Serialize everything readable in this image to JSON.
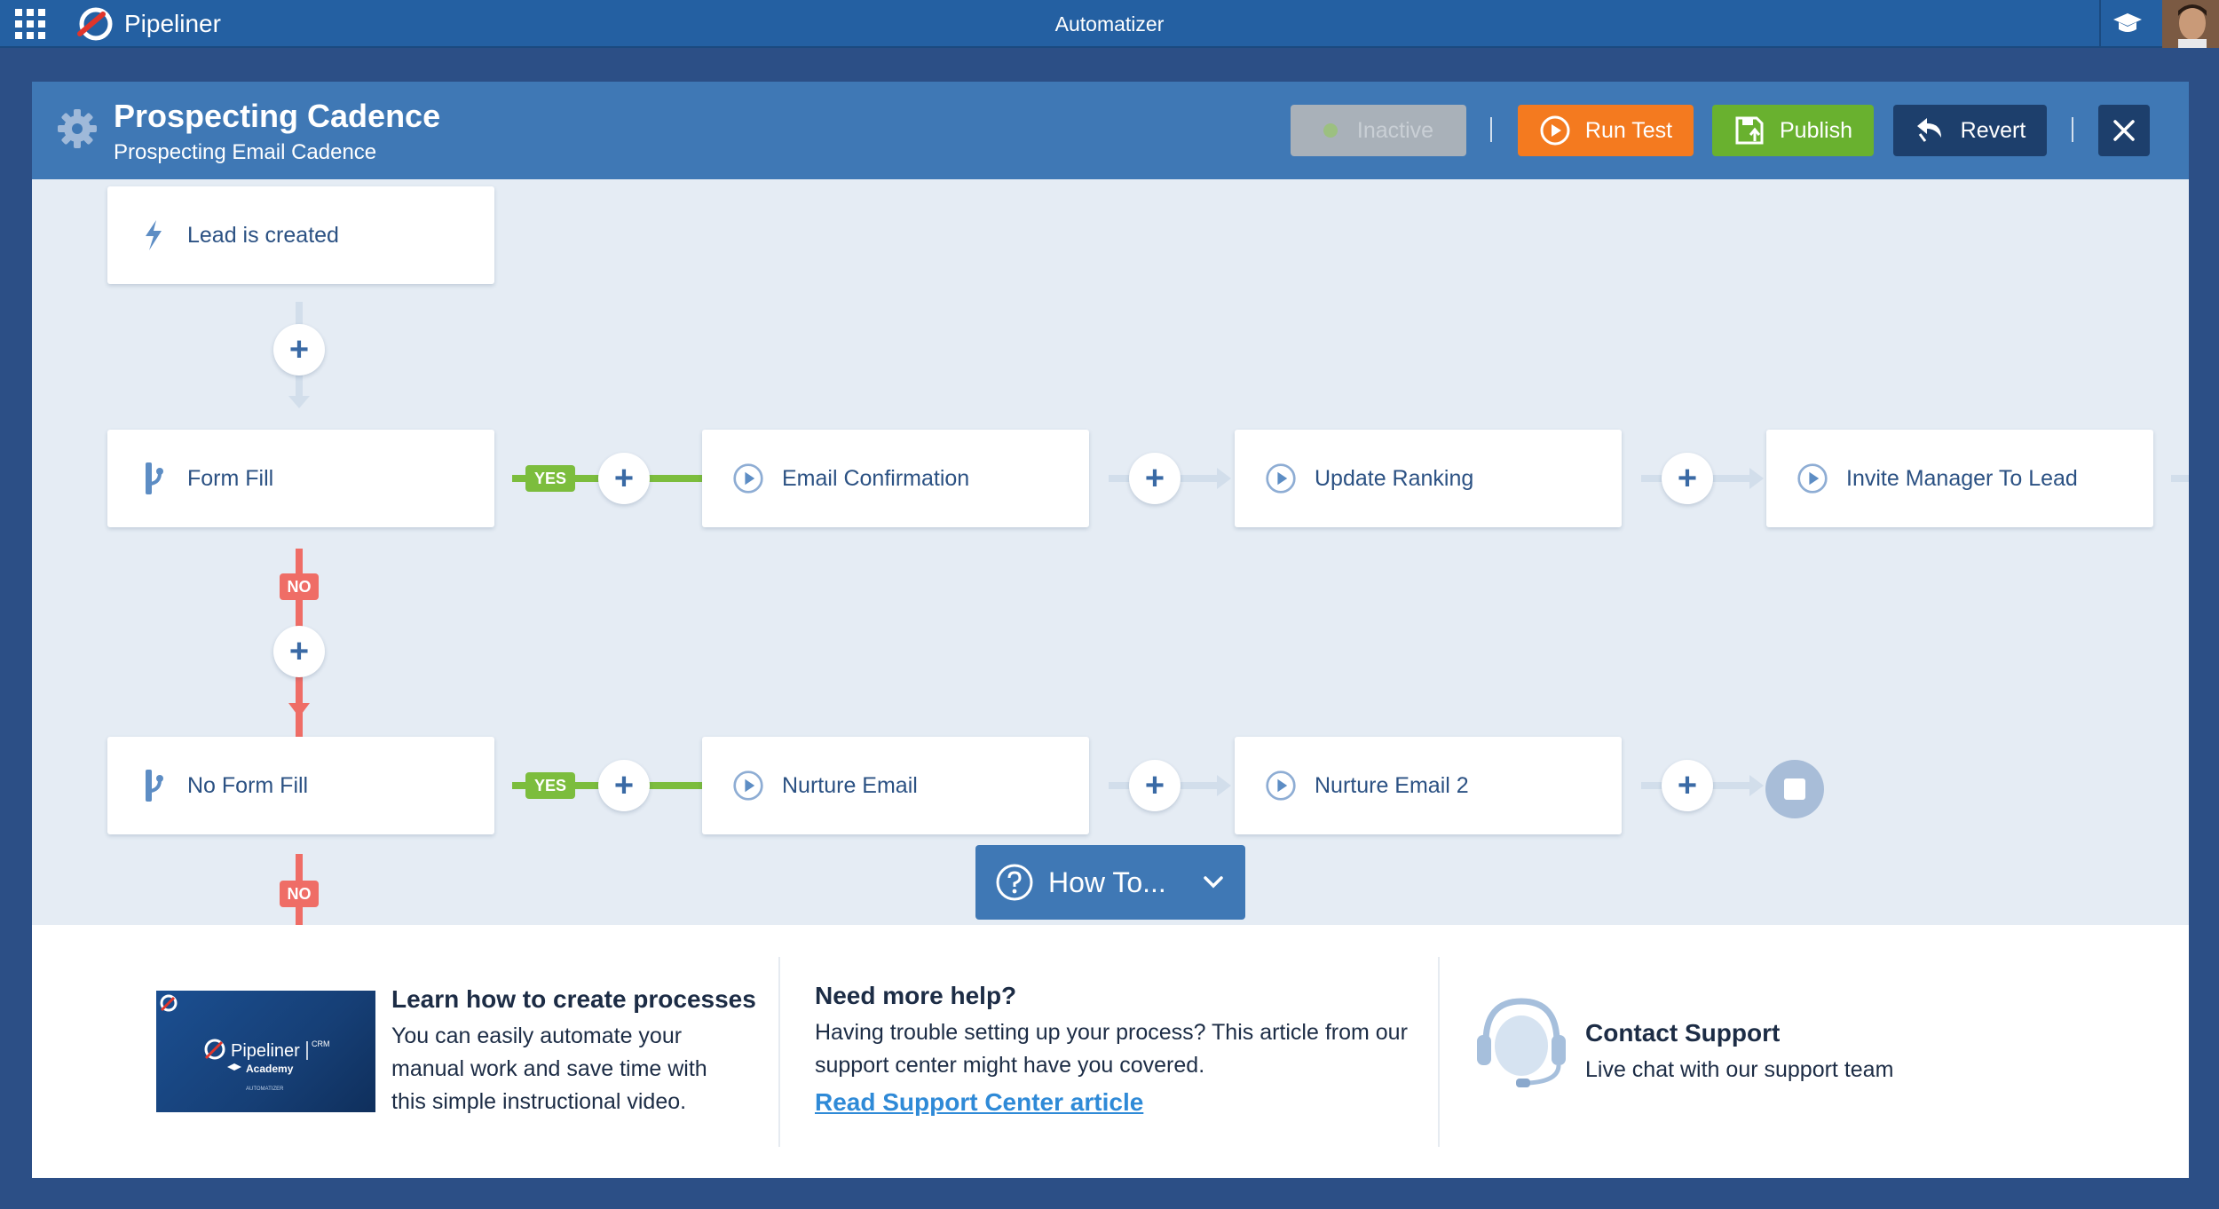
{
  "topbar": {
    "brand": "Pipeliner",
    "app_title": "Automatizer"
  },
  "header": {
    "title": "Prospecting Cadence",
    "subtitle": "Prospecting Email Cadence",
    "inactive_label": "Inactive",
    "run_test_label": "Run Test",
    "publish_label": "Publish",
    "revert_label": "Revert"
  },
  "flow": {
    "trigger": "Lead is created",
    "yes_label": "YES",
    "no_label": "NO",
    "row1": {
      "condition": "Form Fill",
      "actions": [
        "Email Confirmation",
        "Update Ranking",
        "Invite Manager To Lead"
      ]
    },
    "row2": {
      "condition": "No Form Fill",
      "actions": [
        "Nurture Email",
        "Nurture Email 2"
      ]
    }
  },
  "howto_label": "How To...",
  "help": {
    "video": {
      "brand": "Pipeliner",
      "crm": "CRM",
      "academy": "Academy",
      "product": "AUTOMATIZER"
    },
    "learn": {
      "title": "Learn how to create processes",
      "text": "You can easily automate your manual work and save time with this simple instructional video."
    },
    "need": {
      "title": "Need more help?",
      "text": "Having trouble setting up your process? This article from our support center might have you covered.",
      "link": "Read Support Center article"
    },
    "contact": {
      "title": "Contact Support",
      "text": "Live chat with our support team"
    }
  },
  "colors": {
    "topbar": "#2460a2",
    "header": "#3f78b5",
    "run_test": "#f47a1f",
    "publish": "#69b12f",
    "dark_button": "#1d3f6c",
    "yes": "#7cbd3d",
    "no": "#ef6d66"
  }
}
